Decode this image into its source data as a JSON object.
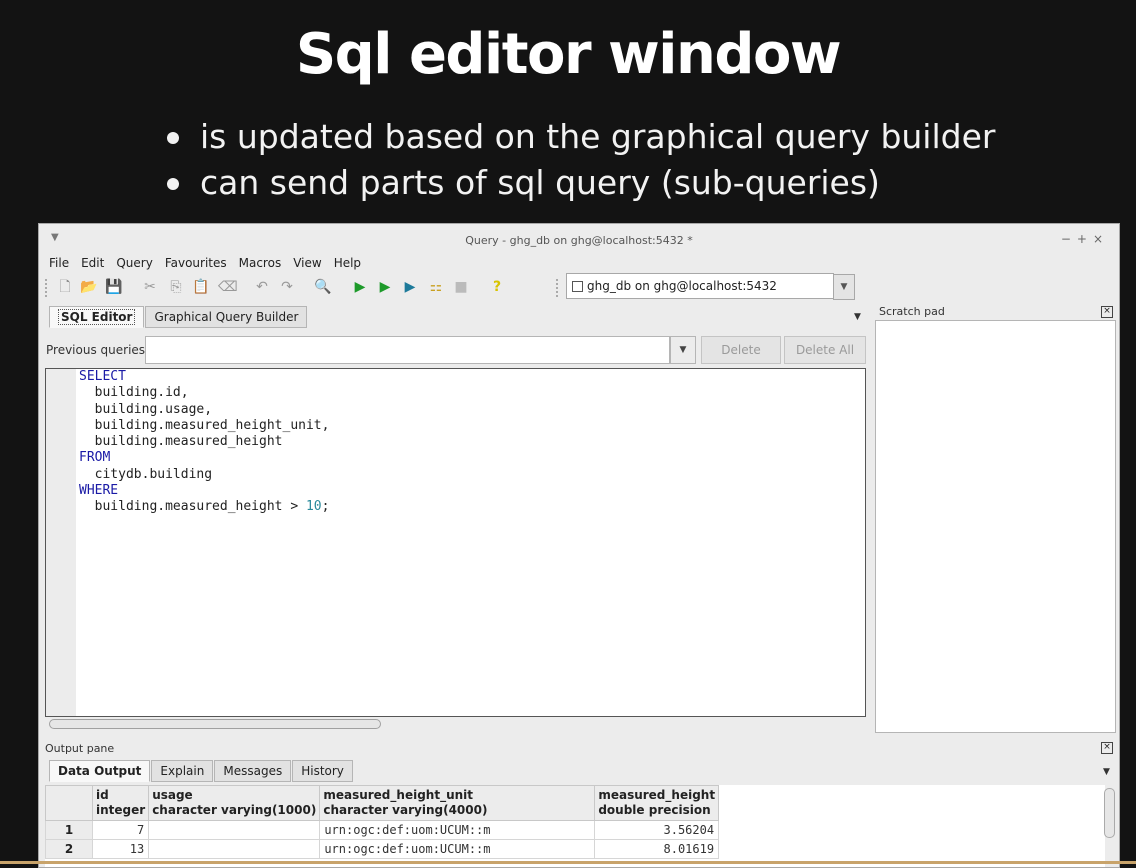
{
  "slide": {
    "title": "Sql editor window",
    "bullets": [
      "is updated based on the graphical query builder",
      "can send parts of sql query (sub-queries)"
    ]
  },
  "window": {
    "title": "Query - ghg_db on ghg@localhost:5432 *",
    "controls": [
      "−",
      "+",
      "×"
    ]
  },
  "menu": [
    "File",
    "Edit",
    "Query",
    "Favourites",
    "Macros",
    "View",
    "Help"
  ],
  "toolbar": {
    "connection": "ghg_db on ghg@localhost:5432",
    "buttons": [
      "new-file",
      "open-folder",
      "save",
      "cut",
      "copy",
      "paste",
      "clear",
      "undo",
      "redo",
      "find",
      "execute",
      "execute-pgscript",
      "execute-to-file",
      "explain",
      "cancel",
      "help"
    ]
  },
  "editor_tabs": [
    "SQL Editor",
    "Graphical Query Builder"
  ],
  "previous_queries": {
    "label": "Previous queries",
    "value": "",
    "delete_label": "Delete",
    "delete_all_label": "Delete All"
  },
  "sql": [
    {
      "kw": "SELECT",
      "text": ""
    },
    {
      "kw": "",
      "text": "  building.id,"
    },
    {
      "kw": "",
      "text": "  building.usage,"
    },
    {
      "kw": "",
      "text": "  building.measured_height_unit,"
    },
    {
      "kw": "",
      "text": "  building.measured_height"
    },
    {
      "kw": "FROM",
      "text": ""
    },
    {
      "kw": "",
      "text": "  citydb.building"
    },
    {
      "kw": "WHERE",
      "text": ""
    },
    {
      "kw": "",
      "text": "  building.measured_height > ",
      "num": "10",
      "tail": ";"
    }
  ],
  "scratch_pad": {
    "label": "Scratch pad"
  },
  "output": {
    "label": "Output pane",
    "tabs": [
      "Data Output",
      "Explain",
      "Messages",
      "History"
    ],
    "columns": [
      {
        "name": "id",
        "type": "integer"
      },
      {
        "name": "usage",
        "type": "character varying(1000)"
      },
      {
        "name": "measured_height_unit",
        "type": "character varying(4000)"
      },
      {
        "name": "measured_height",
        "type": "double precision"
      }
    ],
    "rows": [
      {
        "n": "1",
        "id": "7",
        "usage": "",
        "unit": "urn:ogc:def:uom:UCUM::m",
        "height": "3.56204"
      },
      {
        "n": "2",
        "id": "13",
        "usage": "",
        "unit": "urn:ogc:def:uom:UCUM::m",
        "height": "8.01619"
      }
    ]
  }
}
